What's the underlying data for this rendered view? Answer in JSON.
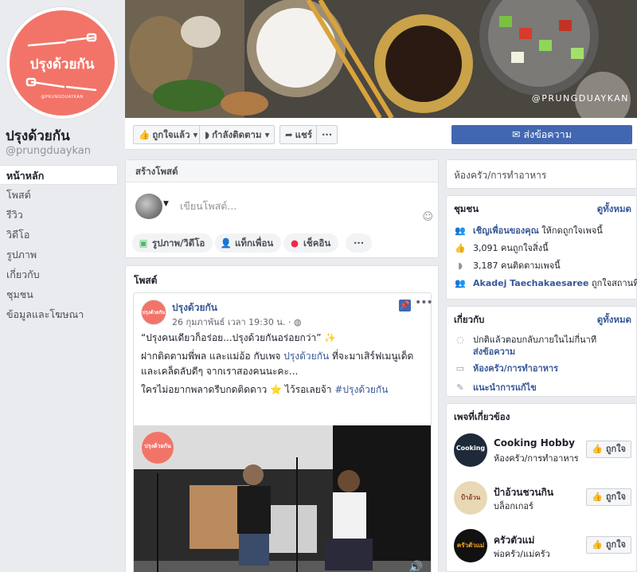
{
  "page": {
    "name": "ปรุงด้วยกัน",
    "handle": "@prungduaykan",
    "logo_text": "ปรุงด้วยกัน",
    "logo_handle": "@PRUNGDUAYKAN",
    "cover_watermark": "@PRUNGDUAYKAN"
  },
  "nav": {
    "items": [
      "หน้าหลัก",
      "โพสต์",
      "รีวิว",
      "วิดีโอ",
      "รูปภาพ",
      "เกี่ยวกับ",
      "ชุมชน",
      "ข้อมูลและโฆษณา"
    ]
  },
  "actionbar": {
    "liked": "ถูกใจแล้ว",
    "following": "กำลังติดตาม",
    "share": "แชร์",
    "more": "···",
    "send_message": "ส่งข้อความ"
  },
  "create_post": {
    "title": "สร้างโพสต์",
    "placeholder": "เขียนโพสต์...",
    "actions": [
      "รูปภาพ/วิดีโอ",
      "แท็กเพื่อน",
      "เช็คอิน",
      "···"
    ]
  },
  "posts_section": {
    "title": "โพสต์",
    "post": {
      "author": "ปรุงด้วยกัน",
      "date": "26 กุมภาพันธ์ เวลา 19:30 น.",
      "line1": "“ปรุงคนเดียวก็อร่อย...ปรุงด้วยกันอร่อยกว่า” ✨",
      "line2_a": "ฝากติดตามพี่พล และแม่อ้อ กับเพจ ",
      "line2_link": "ปรุงด้วยกัน",
      "line2_b": " ที่จะมาเสิร์ฟเมนูเด็ด และเคล็ดลับดีๆ จากเราสองคนนะคะ...",
      "line3_a": "ใครไม่อยากพลาดรีบกดติดดาว ⭐ ไว้รอเลยจ้า ",
      "line3_tag": "#ปรุงด้วยกัน",
      "video_logo": "ปรุงด้วยกัน"
    }
  },
  "right": {
    "category": "ห้องครัว/การทำอาหาร",
    "community": {
      "title": "ชุมชน",
      "see_all": "ดูทั้งหมด",
      "invite_link": "เชิญเพื่อนของคุณ",
      "invite_rest": " ให้กดถูกใจเพจนี้",
      "likes": "3,091 คนถูกใจสิ่งนี้",
      "follows": "3,187 คนติดตามเพจนี้",
      "friend_link": "Akadej Taechakaesaree",
      "friend_rest": " ถูกใจสถานที่นี้"
    },
    "about": {
      "title": "เกี่ยวกับ",
      "see_all": "ดูทั้งหมด",
      "response": "ปกติแล้วตอบกลับภายในไม่กี่นาที",
      "send_message": "ส่งข้อความ",
      "category": "ห้องครัว/การทำอาหาร",
      "suggest_edit": "แนะนำการแก้ไข"
    },
    "related": {
      "title": "เพจที่เกี่ยวข้อง",
      "like_label": "ถูกใจ",
      "items": [
        {
          "name": "Cooking Hobby",
          "category": "ห้องครัว/การทำอาหาร",
          "thumb": "Cooking",
          "color": "#1e2a3a"
        },
        {
          "name": "ป้าอ้วนชวนกิน",
          "category": "บล็อกเกอร์",
          "thumb": "ป้าอ้วน",
          "color": "#e9d8b4"
        },
        {
          "name": "ครัวตัวแม่",
          "category": "พ่อครัว/แม่ครัว",
          "thumb": "ครัวตัวแม่",
          "color": "#111111"
        }
      ]
    }
  }
}
